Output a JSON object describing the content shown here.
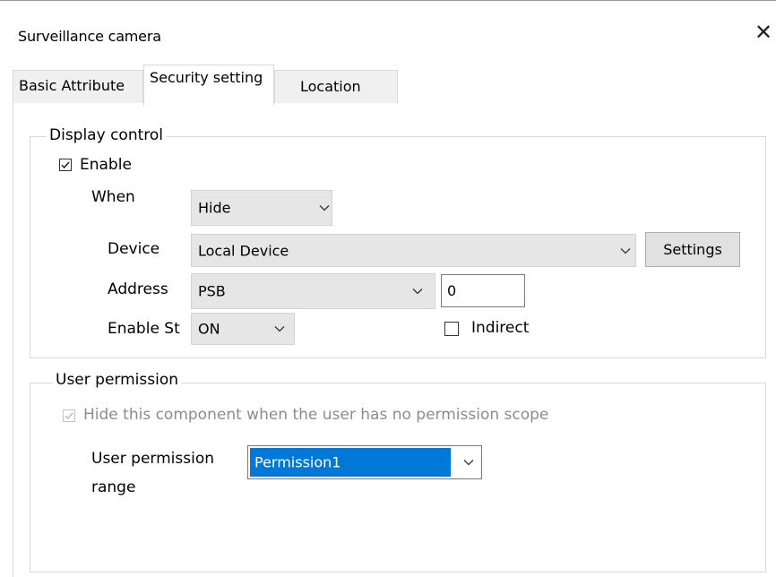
{
  "window": {
    "title": "Surveillance camera"
  },
  "tabs": [
    {
      "label": "Basic Attribute"
    },
    {
      "label": "Security setting"
    },
    {
      "label": "Location"
    }
  ],
  "display_control": {
    "title": "Display control",
    "enable_label": "Enable",
    "enable_checked": true,
    "when_label": "When",
    "when_value": "Hide",
    "device_label": "Device",
    "device_value": "Local Device",
    "settings_label": "Settings",
    "address_label": "Address",
    "address_type": "PSB",
    "address_value": "0",
    "enable_state_label": "Enable St",
    "enable_state_value": "ON",
    "indirect_label": "Indirect",
    "indirect_checked": false
  },
  "user_permission": {
    "title": "User permission",
    "hide_label": "Hide this component when the user has no permission scope",
    "hide_checked": true,
    "hide_disabled": true,
    "range_label_line1": "User permission",
    "range_label_line2": "range",
    "range_value": "Permission1"
  },
  "icons": {
    "close": "close-icon",
    "dropdown": "chevron-down-icon",
    "check": "checkmark-icon"
  },
  "colors": {
    "selection": "#0078d7",
    "combo_bg": "#e6e6e6",
    "border": "#d9d9d9",
    "disabled_text": "#8c8c8c"
  }
}
